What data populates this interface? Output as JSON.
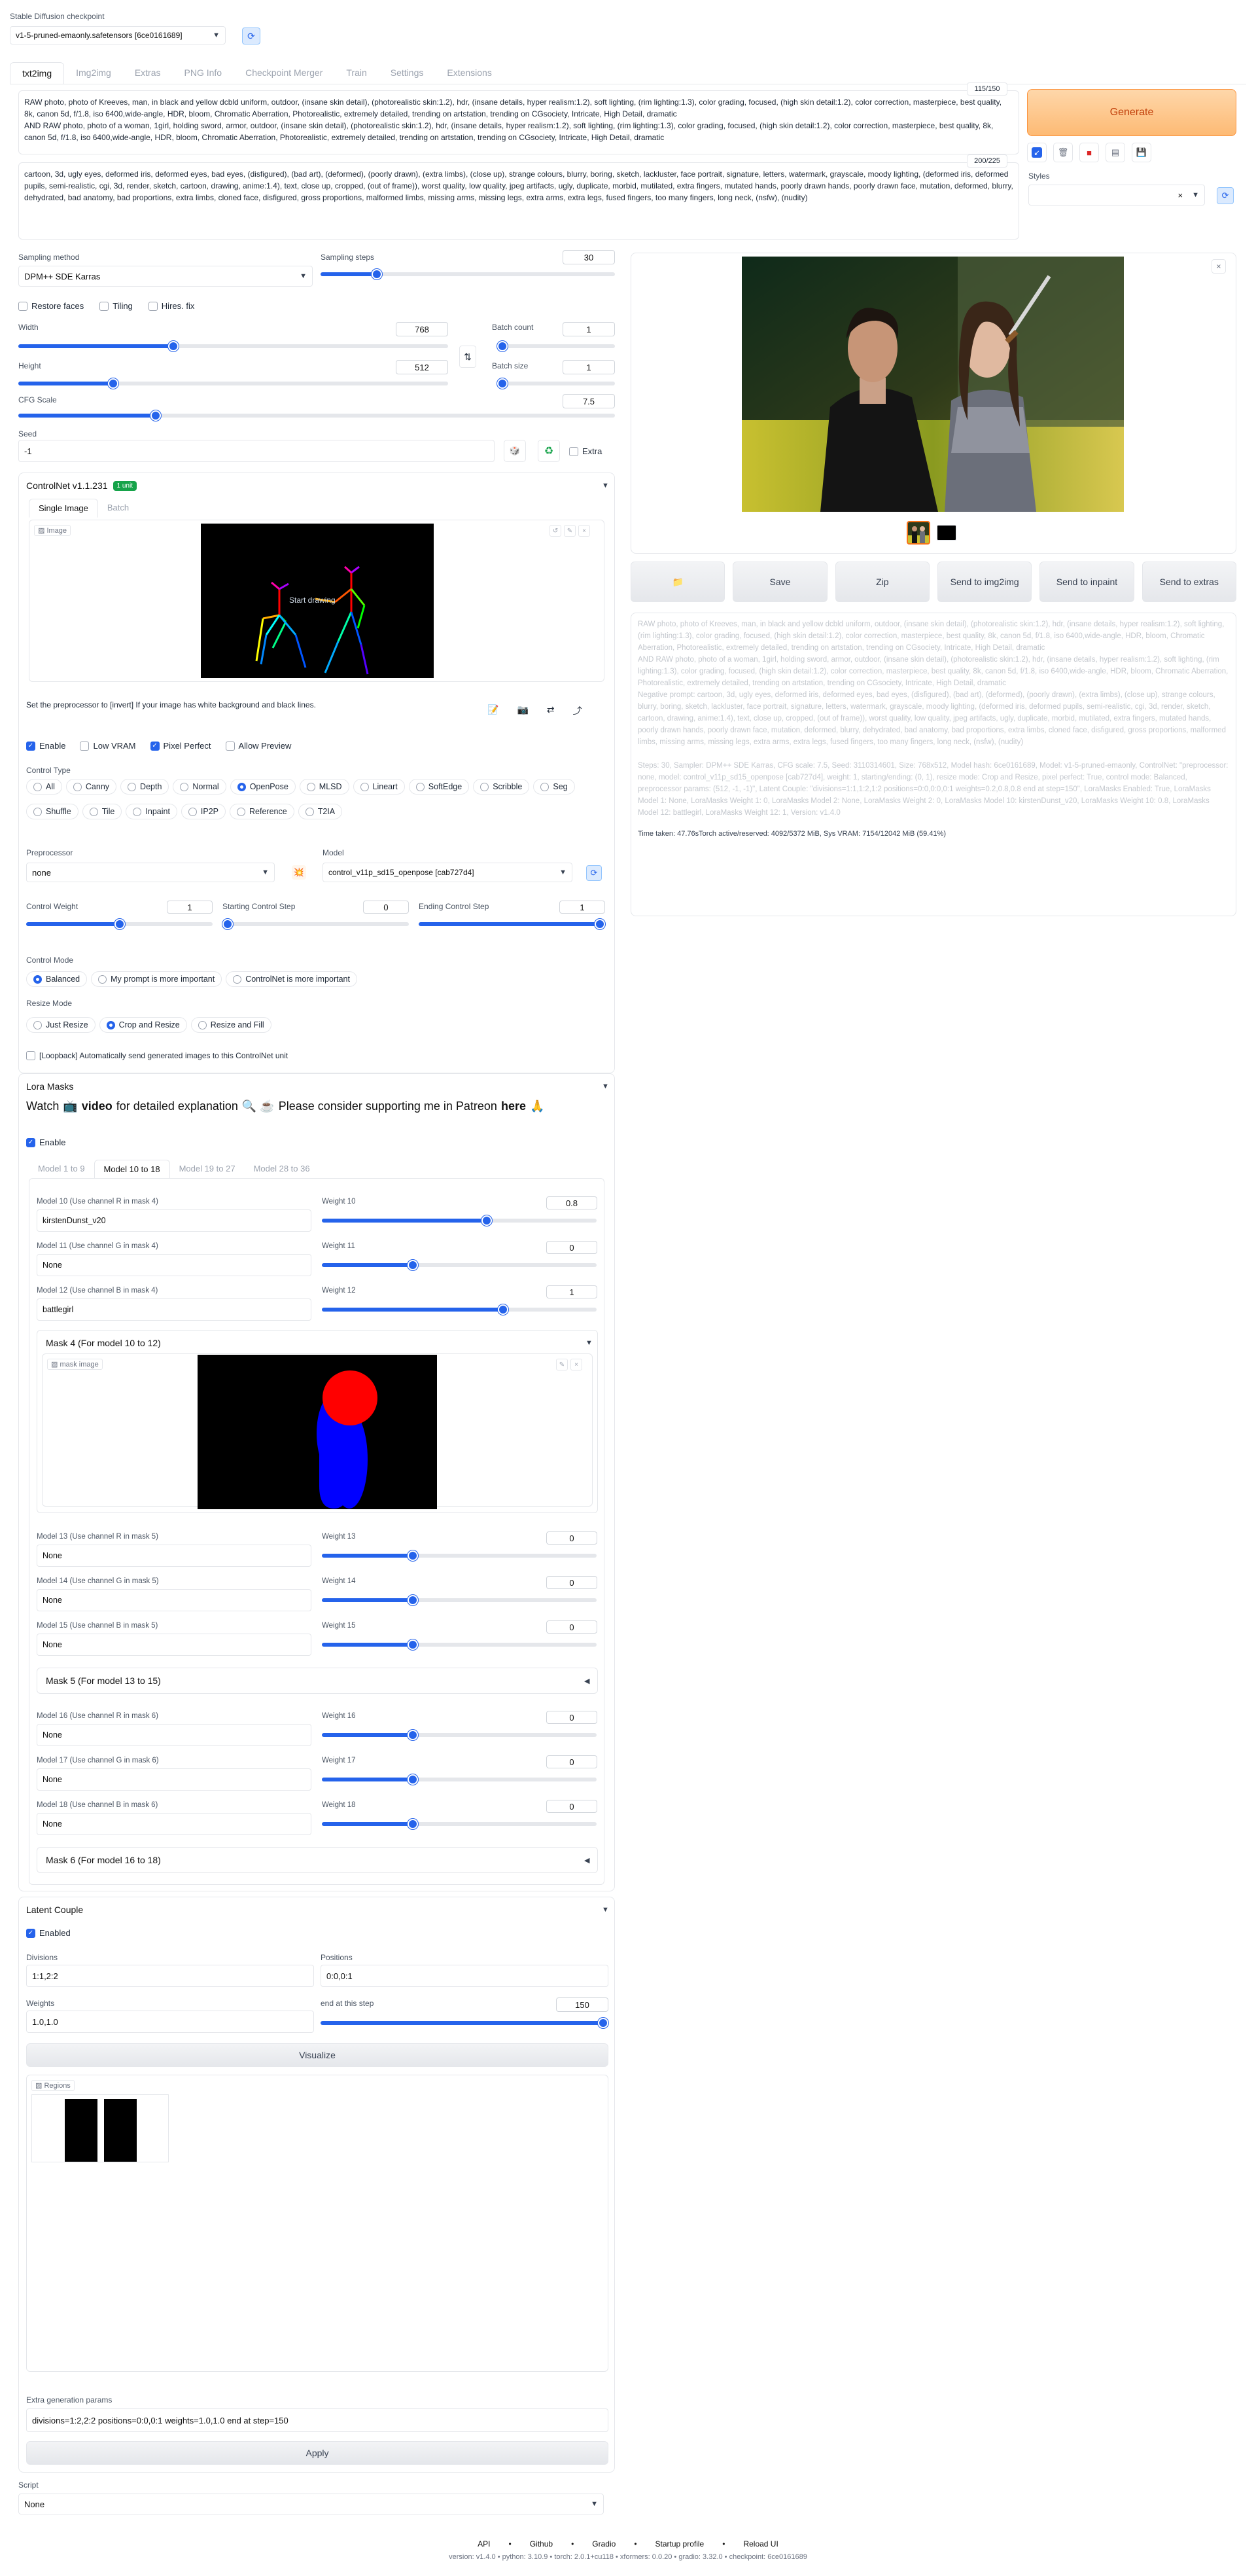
{
  "checkpoint": {
    "label": "Stable Diffusion checkpoint",
    "value": "v1-5-pruned-emaonly.safetensors [6ce0161689]"
  },
  "tabs": [
    "txt2img",
    "Img2img",
    "Extras",
    "PNG Info",
    "Checkpoint Merger",
    "Train",
    "Settings",
    "Extensions"
  ],
  "prompt": {
    "counter": "115/150",
    "text": "RAW photo, photo of Kreeves, man, in black and yellow dcbld uniform, outdoor, (insane skin detail), (photorealistic skin:1.2), hdr, (insane details, hyper realism:1.2), soft lighting, (rim lighting:1.3), color grading, focused, (high skin detail:1.2), color correction, masterpiece, best quality, 8k, canon 5d, f/1.8, iso 6400,wide-angle, HDR, bloom, Chromatic Aberration, Photorealistic, extremely detailed, trending on artstation, trending on CGsociety, Intricate, High Detail, dramatic\nAND RAW photo, photo of a woman, 1girl, holding sword, armor, outdoor, (insane skin detail), (photorealistic skin:1.2), hdr, (insane details, hyper realism:1.2), soft lighting, (rim lighting:1.3), color grading, focused, (high skin detail:1.2), color correction, masterpiece, best quality, 8k, canon 5d, f/1.8, iso 6400,wide-angle, HDR, bloom, Chromatic Aberration, Photorealistic, extremely detailed, trending on artstation, trending on CGsociety, Intricate, High Detail, dramatic"
  },
  "negative": {
    "counter": "200/225",
    "text": "cartoon, 3d, ugly eyes, deformed iris, deformed eyes, bad eyes, (disfigured), (bad art), (deformed), (poorly drawn), (extra limbs), (close up), strange colours, blurry, boring, sketch, lackluster, face portrait, signature, letters, watermark, grayscale, moody lighting, (deformed iris, deformed pupils, semi-realistic, cgi, 3d, render, sketch, cartoon, drawing, anime:1.4), text, close up, cropped, (out of frame)), worst quality, low quality, jpeg artifacts, ugly, duplicate, morbid, mutilated, extra fingers, mutated hands, poorly drawn hands, poorly drawn face, mutation, deformed, blurry, dehydrated, bad anatomy, bad proportions, extra limbs, cloned face, disfigured, gross proportions, malformed limbs, missing arms, missing legs, extra arms, extra legs, fused fingers, too many fingers, long neck, (nsfw), (nudity)"
  },
  "generate": "Generate",
  "styles_label": "Styles",
  "sampling": {
    "method_label": "Sampling method",
    "method": "DPM++ SDE Karras",
    "steps_label": "Sampling steps",
    "steps": "30",
    "steps_frac": 0.19
  },
  "options": {
    "restore": "Restore faces",
    "tiling": "Tiling",
    "hires": "Hires. fix"
  },
  "width": {
    "label": "Width",
    "value": "768",
    "frac": 0.36
  },
  "height": {
    "label": "Height",
    "value": "512",
    "frac": 0.22
  },
  "batch_count": {
    "label": "Batch count",
    "value": "1",
    "frac": 0.0
  },
  "batch_size": {
    "label": "Batch size",
    "value": "1",
    "frac": 0.0
  },
  "cfg": {
    "label": "CFG Scale",
    "value": "7.5",
    "frac": 0.23
  },
  "seed": {
    "label": "Seed",
    "value": "-1",
    "extra": "Extra"
  },
  "controlnet": {
    "title": "ControlNet v1.1.231",
    "badge": "1 unit",
    "tab_single": "Single Image",
    "tab_batch": "Batch",
    "image_label": "Image",
    "canvas_text": "Start drawing",
    "hint": "Set the preprocessor to [invert] If your image has white background and black lines.",
    "enable": "Enable",
    "lowvram": "Low VRAM",
    "pixel_perfect": "Pixel Perfect",
    "allow_preview": "Allow Preview",
    "control_type_label": "Control Type",
    "types": [
      "All",
      "Canny",
      "Depth",
      "Normal",
      "OpenPose",
      "MLSD",
      "Lineart",
      "SoftEdge",
      "Scribble",
      "Seg",
      "Shuffle",
      "Tile",
      "Inpaint",
      "IP2P",
      "Reference",
      "T2IA"
    ],
    "selected_type": "OpenPose",
    "preproc_label": "Preprocessor",
    "preproc": "none",
    "model_label": "Model",
    "model": "control_v11p_sd15_openpose [cab727d4]",
    "weight_label": "Control Weight",
    "weight": "1",
    "start_label": "Starting Control Step",
    "start": "0",
    "end_label": "Ending Control Step",
    "end": "1",
    "mode_label": "Control Mode",
    "modes": [
      "Balanced",
      "My prompt is more important",
      "ControlNet is more important"
    ],
    "resize_label": "Resize Mode",
    "resizes": [
      "Just Resize",
      "Crop and Resize",
      "Resize and Fill"
    ],
    "loopback": "[Loopback] Automatically send generated images to this ControlNet unit"
  },
  "lora": {
    "title": "Lora Masks",
    "watch_pre": "Watch",
    "video_emoji": "📺",
    "watch_link": "video",
    "watch_mid": "for detailed explanation",
    "emojis": "🔍 ☕",
    "support": "Please consider supporting me in Patreon",
    "here": "here",
    "wave": "🙏",
    "enable": "Enable",
    "tabs": [
      "Model 1 to 9",
      "Model 10 to 18",
      "Model 19 to 27",
      "Model 28 to 36"
    ],
    "rows": [
      {
        "label": "Model 10 (Use channel R in mask 4)",
        "value": "kirstenDunst_v20",
        "wlabel": "Weight 10",
        "weight": "0.8",
        "frac": 0.6
      },
      {
        "label": "Model 11 (Use channel G in mask 4)",
        "value": "None",
        "wlabel": "Weight 11",
        "weight": "0",
        "frac": 0.33
      },
      {
        "label": "Model 12 (Use channel B in mask 4)",
        "value": "battlegirl",
        "wlabel": "Weight 12",
        "weight": "1",
        "frac": 0.66
      },
      {
        "label": "Model 13 (Use channel R in mask 5)",
        "value": "None",
        "wlabel": "Weight 13",
        "weight": "0",
        "frac": 0.33
      },
      {
        "label": "Model 14 (Use channel G in mask 5)",
        "value": "None",
        "wlabel": "Weight 14",
        "weight": "0",
        "frac": 0.33
      },
      {
        "label": "Model 15 (Use channel B in mask 5)",
        "value": "None",
        "wlabel": "Weight 15",
        "weight": "0",
        "frac": 0.33
      },
      {
        "label": "Model 16 (Use channel R in mask 6)",
        "value": "None",
        "wlabel": "Weight 16",
        "weight": "0",
        "frac": 0.33
      },
      {
        "label": "Model 17 (Use channel G in mask 6)",
        "value": "None",
        "wlabel": "Weight 17",
        "weight": "0",
        "frac": 0.33
      },
      {
        "label": "Model 18 (Use channel B in mask 6)",
        "value": "None",
        "wlabel": "Weight 18",
        "weight": "0",
        "frac": 0.33
      }
    ],
    "mask4": "Mask 4 (For model 10 to 12)",
    "mask_image": "mask image",
    "mask5": "Mask 5 (For model 13 to 15)",
    "mask6": "Mask 6 (For model 16 to 18)"
  },
  "latent": {
    "title": "Latent Couple",
    "enabled": "Enabled",
    "divisions_label": "Divisions",
    "divisions": "1:1,2:2",
    "positions_label": "Positions",
    "positions": "0:0,0:1",
    "weights_label": "Weights",
    "weights": "1.0,1.0",
    "end_label": "end at this step",
    "end": "150",
    "visualize": "Visualize",
    "regions": "Regions",
    "extra_label": "Extra generation params",
    "extra": "divisions=1:2,2:2 positions=0:0,0:1 weights=1.0,1.0 end at step=150",
    "apply": "Apply"
  },
  "script": {
    "label": "Script",
    "value": "None"
  },
  "output": {
    "buttons": [
      "📁",
      "Save",
      "Zip",
      "Send to img2img",
      "Send to inpaint",
      "Send to extras"
    ],
    "info1": "RAW photo, photo of Kreeves, man, in black and yellow dcbld uniform, outdoor, (insane skin detail), (photorealistic skin:1.2), hdr, (insane details, hyper realism:1.2), soft lighting, (rim lighting:1.3), color grading, focused, (high skin detail:1.2), color correction, masterpiece, best quality, 8k, canon 5d, f/1.8, iso 6400,wide-angle, HDR, bloom, Chromatic Aberration, Photorealistic, extremely detailed, trending on artstation, trending on CGsociety, Intricate, High Detail, dramatic",
    "info2": "AND RAW photo, photo of a woman, 1girl, holding sword, armor, outdoor, (insane skin detail), (photorealistic skin:1.2), hdr, (insane details, hyper realism:1.2), soft lighting, (rim lighting:1.3), color grading, focused, (high skin detail:1.2), color correction, masterpiece, best quality, 8k, canon 5d, f/1.8, iso 6400,wide-angle, HDR, bloom, Chromatic Aberration, Photorealistic, extremely detailed, trending on artstation, trending on CGsociety, Intricate, High Detail, dramatic",
    "info3": "Negative prompt: cartoon, 3d, ugly eyes, deformed iris, deformed eyes, bad eyes, (disfigured), (bad art), (deformed), (poorly drawn), (extra limbs), (close up), strange colours, blurry, boring, sketch, lackluster, face portrait, signature, letters, watermark, grayscale, moody lighting, (deformed iris, deformed pupils, semi-realistic, cgi, 3d, render, sketch, cartoon, drawing, anime:1.4), text, close up, cropped, (out of frame)), worst quality, low quality, jpeg artifacts, ugly, duplicate, morbid, mutilated, extra fingers, mutated hands, poorly drawn hands, poorly drawn face, mutation, deformed, blurry, dehydrated, bad anatomy, bad proportions, extra limbs, cloned face, disfigured, gross proportions, malformed limbs, missing arms, missing legs, extra arms, extra legs, fused fingers, too many fingers, long neck, (nsfw), (nudity)",
    "info4": "Steps: 30, Sampler: DPM++ SDE Karras, CFG scale: 7.5, Seed: 3110314601, Size: 768x512, Model hash: 6ce0161689, Model: v1-5-pruned-emaonly, ControlNet: \"preprocessor: none, model: control_v11p_sd15_openpose [cab727d4], weight: 1, starting/ending: (0, 1), resize mode: Crop and Resize, pixel perfect: True, control mode: Balanced, preprocessor params: (512, -1, -1)\", Latent Couple: \"divisions=1:1,1:2,1:2 positions=0:0,0:0,0:1 weights=0.2,0.8,0.8 end at step=150\", LoraMasks Enabled: True, LoraMasks Model 1: None, LoraMasks Weight 1: 0, LoraMasks Model 2: None, LoraMasks Weight 2: 0, LoraMasks Model 10: kirstenDunst_v20, LoraMasks Weight 10: 0.8, LoraMasks Model 12: battlegirl, LoraMasks Weight 12: 1, Version: v1.4.0",
    "time": "Time taken: 47.76sTorch active/reserved: 4092/5372 MiB, Sys VRAM: 7154/12042 MiB (59.41%)"
  },
  "footer": {
    "links": [
      "API",
      "Github",
      "Gradio",
      "Startup profile",
      "Reload UI"
    ],
    "version": "version: v1.4.0  •  python: 3.10.9  •  torch: 2.0.1+cu118  •  xformers: 0.0.20  •  gradio: 3.32.0  •  checkpoint: 6ce0161689"
  },
  "colors": {
    "accent": "#2563eb",
    "generate_bg": "#fdba74",
    "generate_text": "#c2410c",
    "badge": "#16a34a"
  }
}
